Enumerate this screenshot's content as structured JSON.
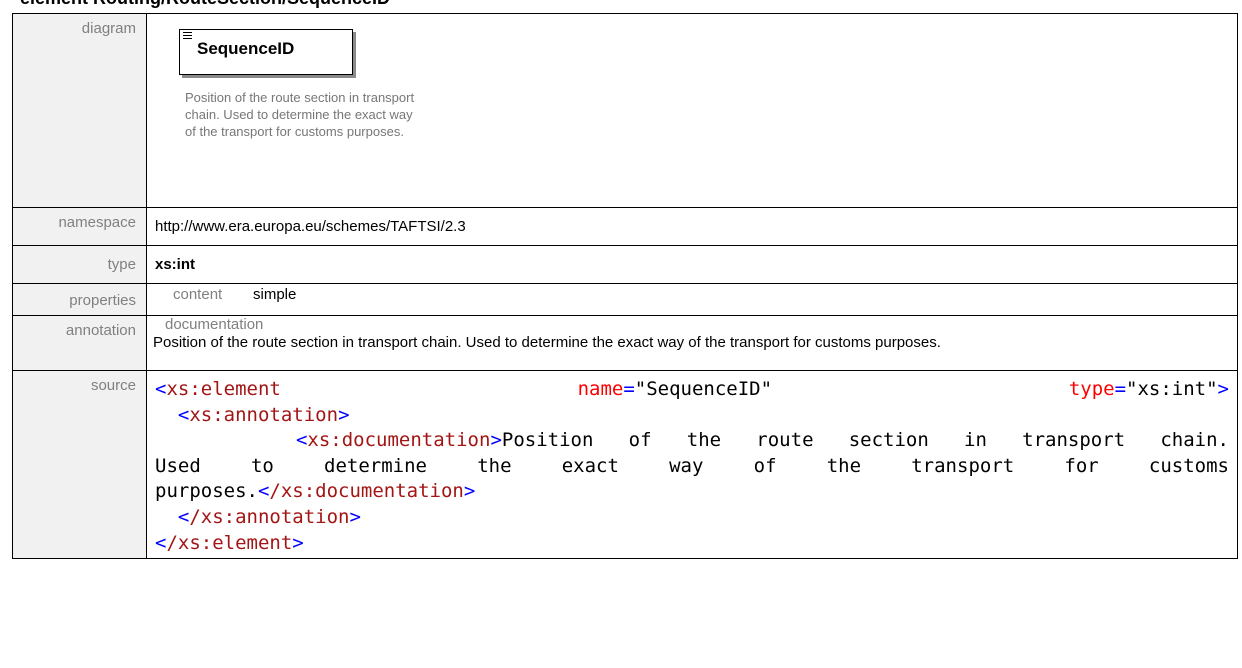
{
  "page_title": "element Routing/RouteSection/SequenceID",
  "labels": {
    "diagram": "diagram",
    "namespace": "namespace",
    "type": "type",
    "properties": "properties",
    "annotation": "annotation",
    "source": "source"
  },
  "diagram": {
    "element_name": "SequenceID",
    "documentation": "Position of the route section in transport chain. Used to determine the exact way of the transport for customs purposes."
  },
  "namespace": "http://www.era.europa.eu/schemes/TAFTSI/2.3",
  "type": "xs:int",
  "properties": {
    "key": "content",
    "value": "simple"
  },
  "annotation": {
    "key": "documentation",
    "text": "Position of the route section in transport chain. Used to determine the exact way of the transport for customs purposes."
  },
  "source": {
    "l1_tag": "xs:element",
    "l1_attr1": "name",
    "l1_val1": "\"SequenceID\"",
    "l1_attr2": "type",
    "l1_val2": "\"xs:int\"",
    "l2_tag": "xs:annotation",
    "l3_tag": "xs:documentation",
    "l3_text_a": "Position of the route section in transport chain.",
    "l3_text_b": "Used to determine the exact way of the transport for customs",
    "l3_text_c": "purposes.",
    "l3_close": "/xs:documentation",
    "l4_close": "/xs:annotation",
    "l5_close": "/xs:element"
  },
  "colors": {
    "tag": "#a31515",
    "bracket": "#0000ff",
    "attribute": "#ff0000",
    "label_bg": "#f1f1f1",
    "label_text": "#808080"
  }
}
